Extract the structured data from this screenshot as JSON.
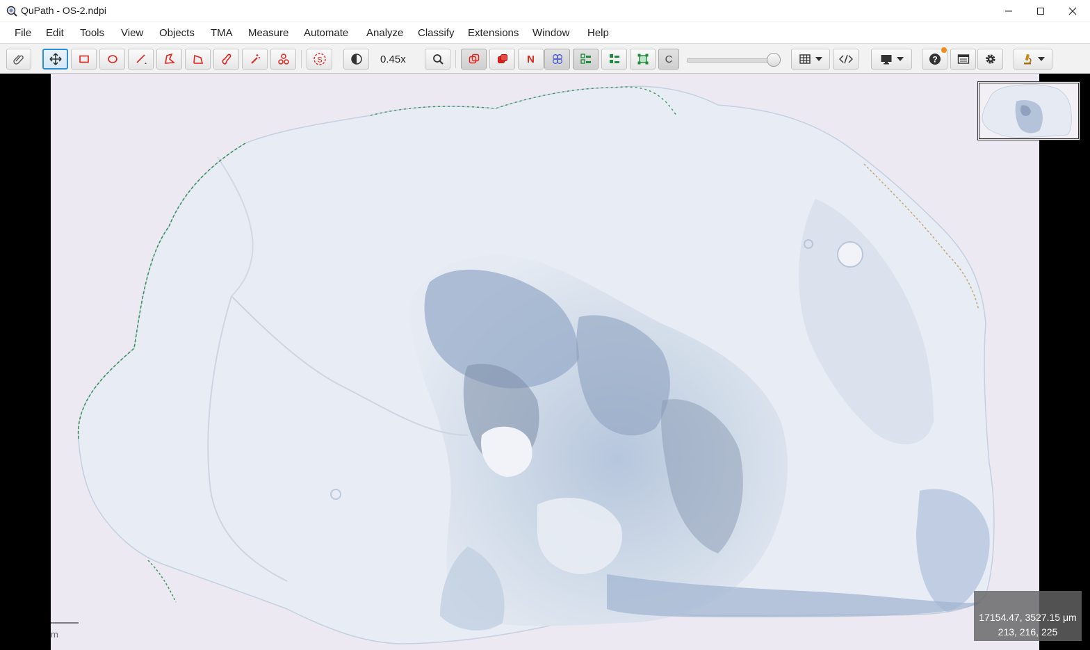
{
  "window": {
    "title": "QuPath - OS-2.ndpi",
    "minimize_label": "minimize",
    "maximize_label": "maximize",
    "close_label": "close"
  },
  "menu": [
    "File",
    "Edit",
    "Tools",
    "View",
    "Objects",
    "TMA",
    "Measure",
    "Automate",
    "Analyze",
    "Classify",
    "Extensions",
    "Window",
    "Help"
  ],
  "toolbar": {
    "zoom": "0.45x",
    "channel_button": "C",
    "points_button": "N",
    "brightness_slider_value": 1.0,
    "icons": {
      "analysis_pane": "paperclip-icon",
      "move": "move-icon",
      "rectangle": "rectangle-icon",
      "ellipse": "ellipse-icon",
      "line": "line-icon",
      "polygon": "polygon-icon",
      "polyline": "polyline-icon",
      "brush": "brush-icon",
      "wand": "wand-icon",
      "points": "points-icon",
      "selection_mode": "selection-mode-icon",
      "brightness_contrast": "contrast-icon",
      "zoom_to_fit": "zoom-icon",
      "show_annotations": "annotations-icon",
      "fill_annotations": "fill-annotations-icon",
      "show_names": "names-icon",
      "show_tma_grid": "tma-grid-icon",
      "show_detections": "detections-icon",
      "fill_detections": "fill-detections-icon",
      "show_pixel_classification": "pixel-classification-icon",
      "measurement_tables": "table-icon",
      "script_editor": "code-icon",
      "viewer_display": "monitor-icon",
      "help": "help-icon",
      "log": "log-icon",
      "preferences": "gear-icon",
      "extensions": "microscope-icon"
    }
  },
  "viewer": {
    "cursor_location": "17154.47, 3527.15 μm",
    "pixel_value": "213, 216, 225",
    "scale_label": "m"
  },
  "colors": {
    "accent_blue": "#2a8fd8",
    "tool_red": "#e0241b",
    "notification": "#f28c1c",
    "slide_background": "#ece9f2",
    "tissue_stain": "#a9bedb",
    "tissue_edge_green": "#1e8a3e"
  }
}
